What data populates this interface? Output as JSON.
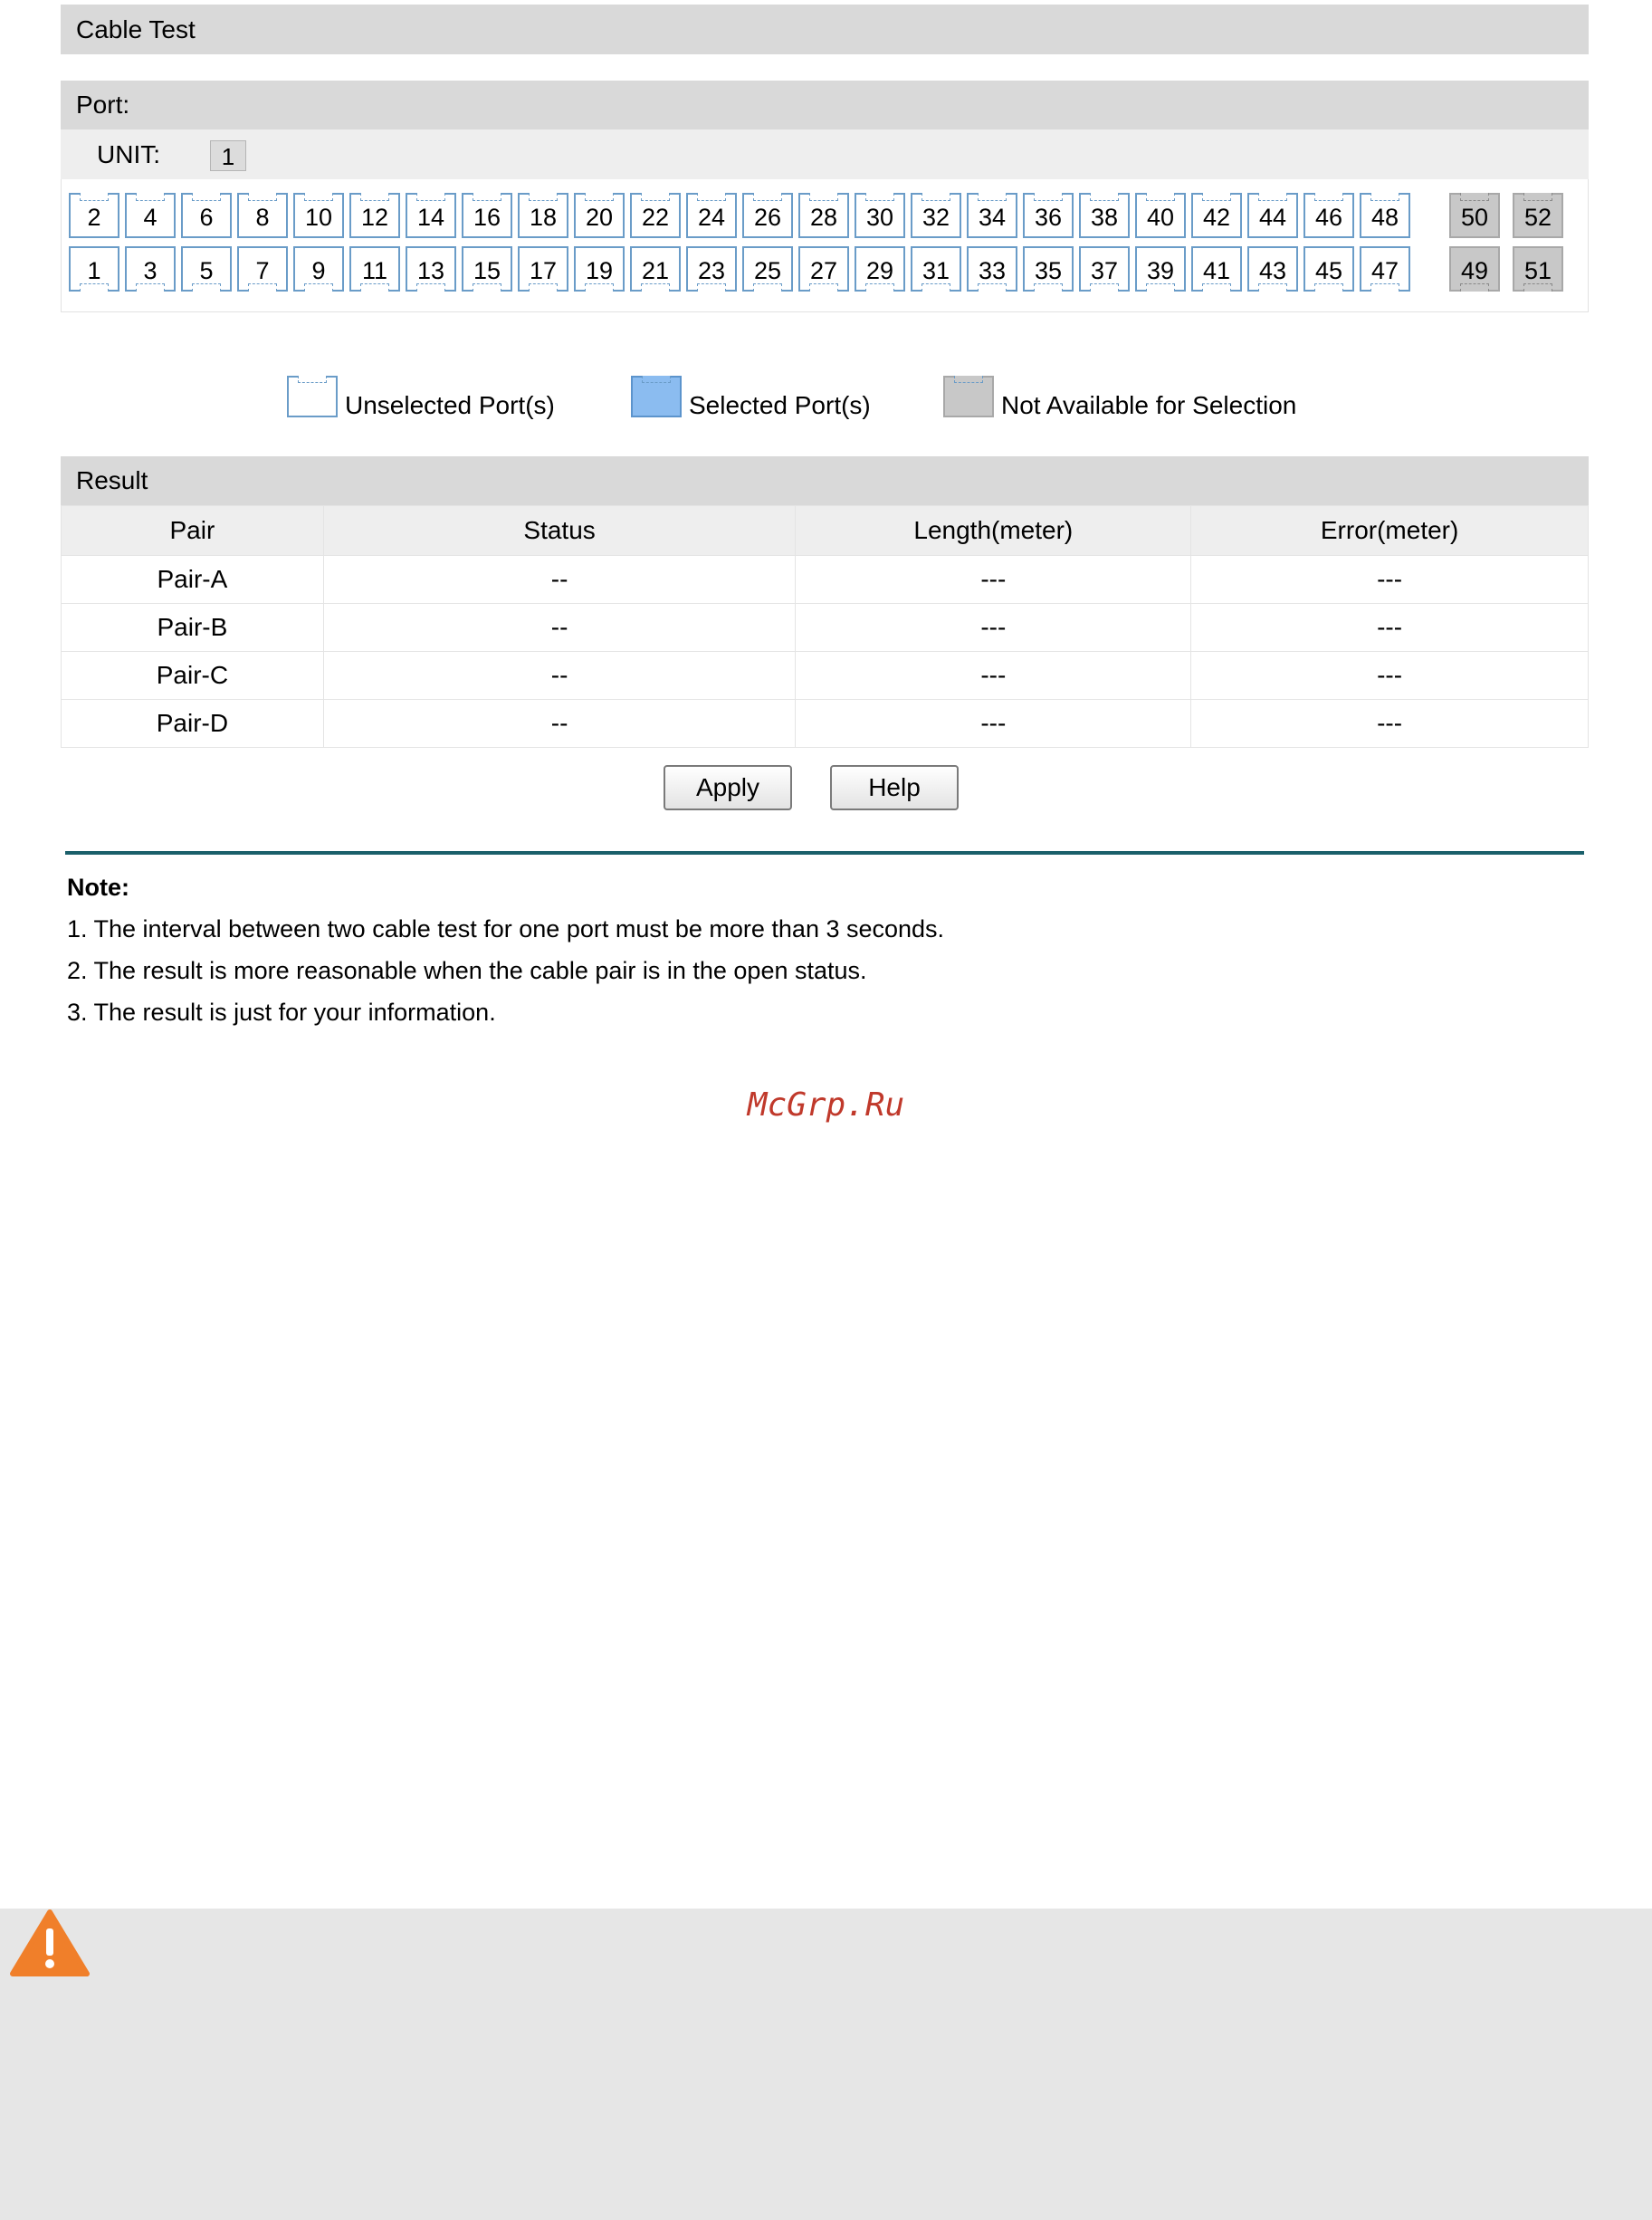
{
  "title": "Cable Test",
  "port_section": {
    "label": "Port:",
    "unit_label": "UNIT:",
    "unit_value": "1",
    "even_ports": [
      "2",
      "4",
      "6",
      "8",
      "10",
      "12",
      "14",
      "16",
      "18",
      "20",
      "22",
      "24",
      "26",
      "28",
      "30",
      "32",
      "34",
      "36",
      "38",
      "40",
      "42",
      "44",
      "46",
      "48"
    ],
    "odd_ports": [
      "1",
      "3",
      "5",
      "7",
      "9",
      "11",
      "13",
      "15",
      "17",
      "19",
      "21",
      "23",
      "25",
      "27",
      "29",
      "31",
      "33",
      "35",
      "37",
      "39",
      "41",
      "43",
      "45",
      "47"
    ],
    "sfp_even": [
      "50",
      "52"
    ],
    "sfp_odd": [
      "49",
      "51"
    ]
  },
  "legend": {
    "unselected": "Unselected Port(s)",
    "selected": "Selected Port(s)",
    "not_available": "Not Available for Selection"
  },
  "result": {
    "label": "Result",
    "columns": [
      "Pair",
      "Status",
      "Length(meter)",
      "Error(meter)"
    ],
    "rows": [
      [
        "Pair-A",
        "--",
        "---",
        "---"
      ],
      [
        "Pair-B",
        "--",
        "---",
        "---"
      ],
      [
        "Pair-C",
        "--",
        "---",
        "---"
      ],
      [
        "Pair-D",
        "--",
        "---",
        "---"
      ]
    ]
  },
  "buttons": {
    "apply": "Apply",
    "help": "Help"
  },
  "note": {
    "title": "Note:",
    "lines": [
      "1. The interval between two cable test for one port must be more than 3 seconds.",
      "2. The result is more reasonable when the cable pair is in the open status.",
      "3. The result is just for your information."
    ]
  },
  "watermark": "McGrp.Ru",
  "colors": {
    "port_border": "#6a9cc8",
    "selected_fill": "#8bbcf0",
    "not_available_fill": "#c8c8c8",
    "warning_orange": "#f07f2a",
    "divider": "#1a5f6a"
  },
  "icons": {
    "warning": "warning-triangle-icon"
  }
}
